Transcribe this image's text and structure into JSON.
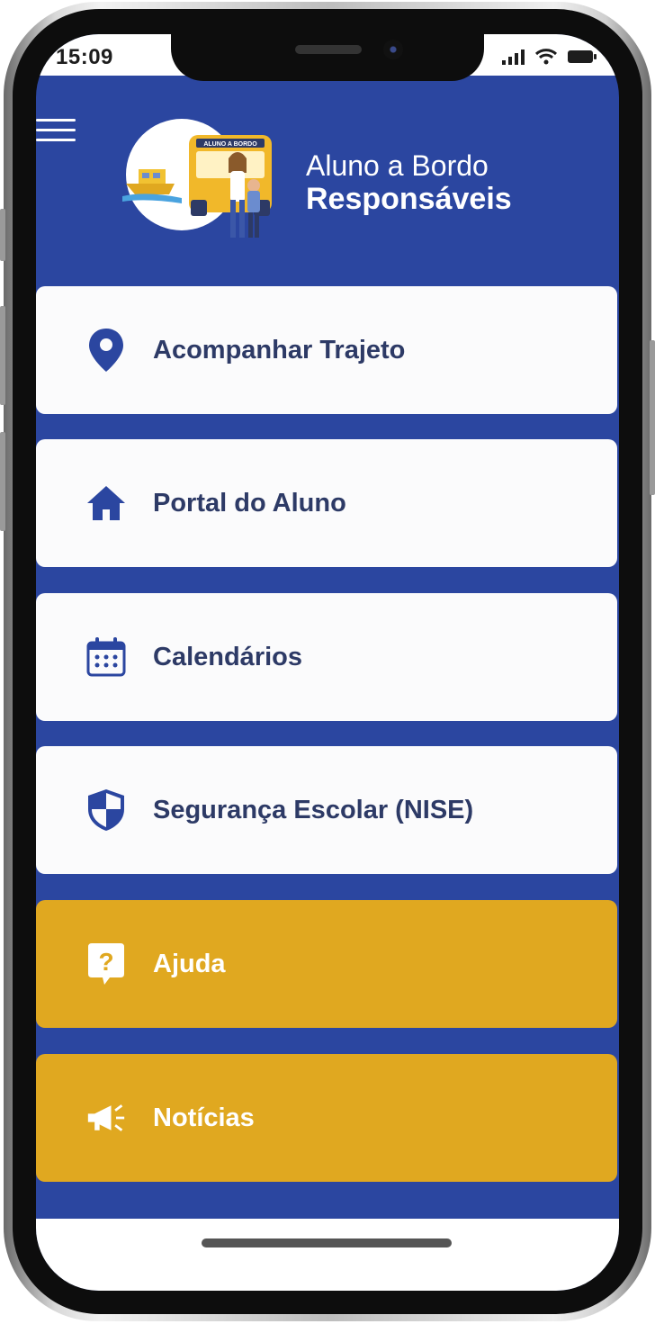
{
  "status_bar": {
    "time": "15:09"
  },
  "header": {
    "app_name_line1": "Aluno a Bordo",
    "app_name_line2": "Responsáveis",
    "bus_sign": "ALUNO A BORDO"
  },
  "menu": {
    "items": [
      {
        "label": "Acompanhar Trajeto",
        "icon": "map-pin-icon",
        "style": "white"
      },
      {
        "label": "Portal do Aluno",
        "icon": "home-icon",
        "style": "white"
      },
      {
        "label": "Calendários",
        "icon": "calendar-icon",
        "style": "white"
      },
      {
        "label": "Segurança Escolar (NISE)",
        "icon": "shield-icon",
        "style": "white"
      },
      {
        "label": "Ajuda",
        "icon": "help-icon",
        "style": "gold"
      },
      {
        "label": "Notícias",
        "icon": "megaphone-icon",
        "style": "gold"
      }
    ]
  },
  "colors": {
    "background": "#2b46a0",
    "card_white": "#fbfbfc",
    "card_gold": "#e0a820",
    "text_dark": "#2d3a66",
    "icon_blue": "#2b46a0"
  }
}
